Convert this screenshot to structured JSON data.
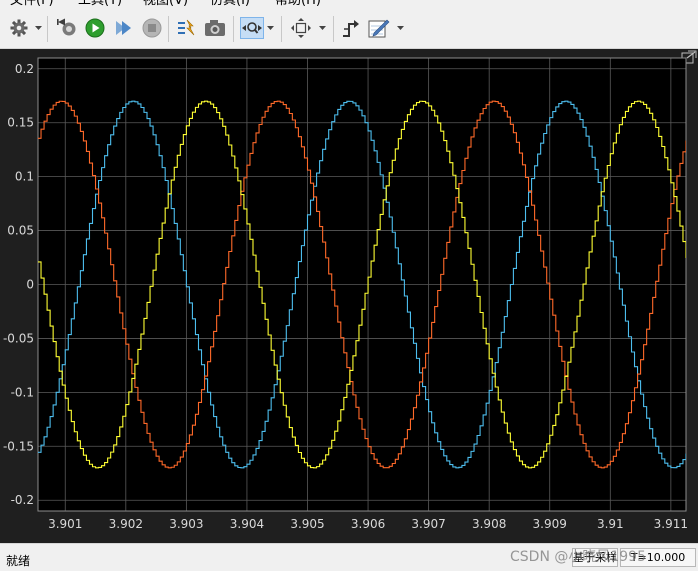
{
  "menu": {
    "items": [
      {
        "label": "文件(F)"
      },
      {
        "label": "工具(T)"
      },
      {
        "label": "视图(V)"
      },
      {
        "label": "仿真(I)"
      },
      {
        "label": "帮助(H)"
      }
    ]
  },
  "toolbar": {
    "buttons": [
      {
        "icon": "gear-icon"
      },
      {
        "icon": "step-back-icon"
      },
      {
        "icon": "run-icon"
      },
      {
        "icon": "step-forward-icon"
      },
      {
        "icon": "stop-icon"
      },
      {
        "icon": "signal-highlight-icon"
      },
      {
        "icon": "snapshot-icon"
      },
      {
        "icon": "zoom-x-icon",
        "selected": true
      },
      {
        "icon": "autoscale-icon"
      },
      {
        "icon": "triggers-icon"
      },
      {
        "icon": "style-icon"
      }
    ]
  },
  "status": {
    "text": "就绪",
    "mode": "基于采样",
    "time": "T=10.000"
  },
  "watermark": "CSDN @小晓风1995",
  "colors": {
    "background": "#000000",
    "grid": "#5a5a5a",
    "tick_text": "#d9d9d9",
    "series": [
      "#4dbeee",
      "#ff6929",
      "#ffff33"
    ]
  },
  "chart_data": {
    "type": "line",
    "xlim": [
      3.90055,
      3.91125
    ],
    "ylim": [
      -0.21,
      0.21
    ],
    "xticks": [
      3.901,
      3.902,
      3.903,
      3.904,
      3.905,
      3.906,
      3.907,
      3.908,
      3.909,
      3.91,
      3.911
    ],
    "xtick_labels": [
      "3.901",
      "3.902",
      "3.903",
      "3.904",
      "3.905",
      "3.906",
      "3.907",
      "3.908",
      "3.909",
      "3.91",
      "3.911"
    ],
    "yticks": [
      0.2,
      0.15,
      0.1,
      0.05,
      0,
      -0.05,
      -0.1,
      -0.15,
      -0.2
    ],
    "ytick_labels": [
      "0.2",
      "0.15",
      "0.1",
      "0.05",
      "0",
      "-0.05",
      "-0.1",
      "-0.15",
      "-0.2"
    ],
    "grid": true,
    "stairs": true,
    "step": 5e-05,
    "series": [
      {
        "color": "#4dbeee",
        "amplitude": 0.17,
        "frequency": 280,
        "peak_t": 3.9021
      },
      {
        "color": "#ff6929",
        "amplitude": 0.17,
        "frequency": 280,
        "peak_t": 3.90449
      },
      {
        "color": "#ffff33",
        "amplitude": 0.17,
        "frequency": 280,
        "peak_t": 3.90687
      }
    ]
  }
}
